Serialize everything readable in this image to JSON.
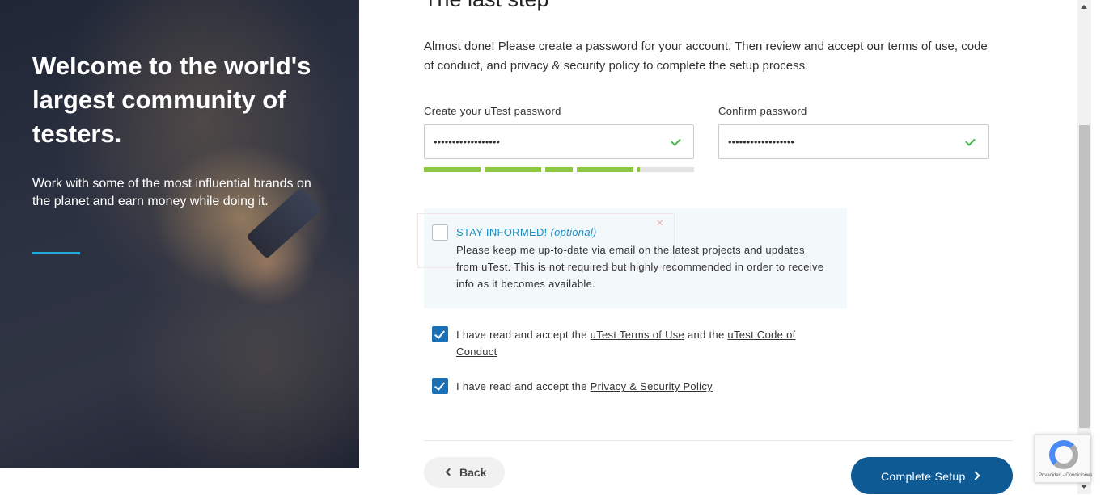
{
  "hero": {
    "title": "Welcome to the world's largest community of testers.",
    "subtitle": "Work with some of the most influential brands on the planet and earn money while doing it.",
    "accent_color": "#1ea9d8"
  },
  "step": {
    "title": "The last step",
    "intro": "Almost done! Please create a password for your account. Then review and accept our terms of use, code of conduct, and privacy & security policy to complete the setup process."
  },
  "password": {
    "create_label": "Create your uTest password",
    "create_value": "••••••••••••••••••",
    "confirm_label": "Confirm password",
    "confirm_value": "••••••••••••••••••",
    "strength_colors": [
      "#8dc63f",
      "#e3e3e3"
    ],
    "strength_level": 0.8
  },
  "stay_informed": {
    "heading": "STAY INFORMED!",
    "optional": "(optional)",
    "body": "Please keep me up-to-date via email on the latest projects and updates from uTest. This is not required but highly recommended in order to receive info as it becomes available.",
    "checked": false,
    "dismiss_glyph": "×"
  },
  "terms": {
    "prefix": "I have read and accept the",
    "terms_link": "uTest Terms of Use",
    "and": "and the",
    "conduct_link": "uTest Code of Conduct",
    "checked": true
  },
  "privacy": {
    "prefix": "I have read and accept the",
    "link": "Privacy & Security Policy",
    "checked": true
  },
  "actions": {
    "back": "Back",
    "complete": "Complete Setup",
    "primary_color": "#0e5a95"
  },
  "recaptcha": {
    "text": "Privacidad - Condiciones"
  }
}
